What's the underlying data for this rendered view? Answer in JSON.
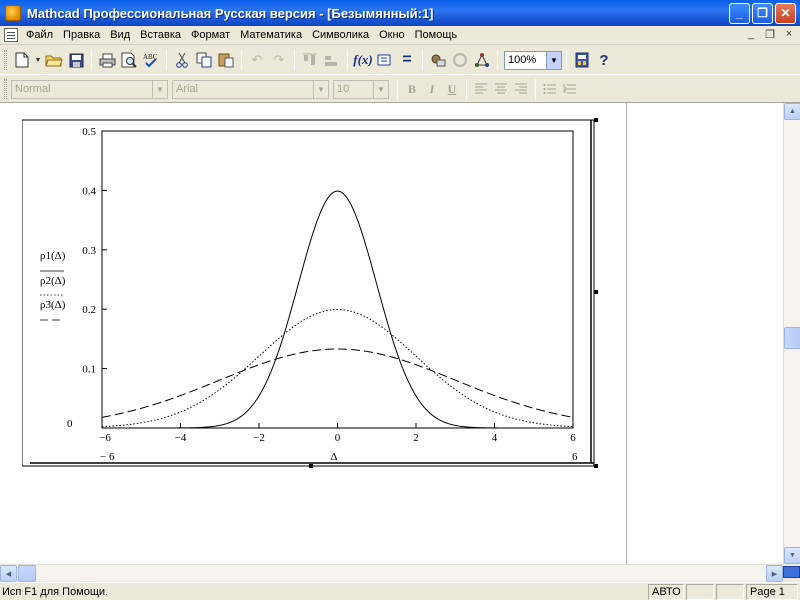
{
  "window": {
    "title": "Mathcad Профессиональная Русская версия - [Безымянный:1]",
    "buttons": {
      "minimize": "_",
      "restore": "❐",
      "close": "✕"
    }
  },
  "menu": {
    "items": [
      "Файл",
      "Правка",
      "Вид",
      "Вставка",
      "Формат",
      "Математика",
      "Символика",
      "Окно",
      "Помощь"
    ],
    "mdi": {
      "minimize": "_",
      "restore": "❐",
      "close": "×"
    }
  },
  "toolbar": {
    "zoom": "100%",
    "icons": [
      "new-doc-icon",
      "open-folder-icon",
      "save-icon",
      "print-icon",
      "print-preview-icon",
      "spell-check-icon",
      "cut-icon",
      "copy-icon",
      "paste-icon",
      "undo-icon",
      "redo-icon",
      "align-icon",
      "distribute-icon",
      "insert-function-icon",
      "insert-unit-icon",
      "calculate-icon",
      "insert-component-icon",
      "resources-icon",
      "help-icon"
    ]
  },
  "format_toolbar": {
    "style": "Normal",
    "font": "Arial",
    "size": "10",
    "bold": "B",
    "italic": "I",
    "underline": "U"
  },
  "status": {
    "help_text": "Исп F1 для Помощи.",
    "mode": "АВТО",
    "page": "Page 1"
  },
  "graph": {
    "ylabels": [
      "ρ1(Δ)",
      "ρ2(Δ)",
      "ρ3(Δ)"
    ],
    "xlabel": "Δ",
    "x_min_label": "− 6",
    "x_max_label": "6",
    "y_bottom_label": "0"
  },
  "chart_data": {
    "type": "line",
    "xlim": [
      -6,
      6
    ],
    "ylim": [
      0,
      0.5
    ],
    "x_ticks": [
      "−6",
      "−4",
      "−2",
      "0",
      "2",
      "4",
      "6"
    ],
    "y_ticks": [
      "0.1",
      "0.2",
      "0.3",
      "0.4",
      "0.5"
    ],
    "x_tick_values": [
      -6,
      -4,
      -2,
      0,
      2,
      4,
      6
    ],
    "y_tick_values": [
      0.1,
      0.2,
      0.3,
      0.4,
      0.5
    ],
    "grid": false,
    "series": [
      {
        "name": "ρ1(Δ)",
        "style": "solid",
        "sigma": 1,
        "x": [
          -6,
          -5,
          -4,
          -3,
          -2.5,
          -2,
          -1.5,
          -1,
          -0.5,
          0,
          0.5,
          1,
          1.5,
          2,
          2.5,
          3,
          4,
          5,
          6
        ],
        "y": [
          0.0,
          0.0,
          0.0001,
          0.0044,
          0.0175,
          0.054,
          0.1295,
          0.242,
          0.352,
          0.399,
          0.352,
          0.242,
          0.1295,
          0.054,
          0.0175,
          0.0044,
          0.0001,
          0.0,
          0.0
        ]
      },
      {
        "name": "ρ2(Δ)",
        "style": "dotted",
        "sigma": 2,
        "x": [
          -6,
          -5,
          -4,
          -3,
          -2,
          -1,
          0,
          1,
          2,
          3,
          4,
          5,
          6
        ],
        "y": [
          0.0022,
          0.0088,
          0.027,
          0.0648,
          0.121,
          0.176,
          0.1995,
          0.176,
          0.121,
          0.0648,
          0.027,
          0.0088,
          0.0022
        ]
      },
      {
        "name": "ρ3(Δ)",
        "style": "dashed",
        "sigma": 3,
        "x": [
          -6,
          -5,
          -4,
          -3,
          -2,
          -1,
          0,
          1,
          2,
          3,
          4,
          5,
          6
        ],
        "y": [
          0.018,
          0.033,
          0.0547,
          0.0807,
          0.1065,
          0.1258,
          0.133,
          0.1258,
          0.1065,
          0.0807,
          0.0547,
          0.033,
          0.018
        ]
      }
    ]
  }
}
